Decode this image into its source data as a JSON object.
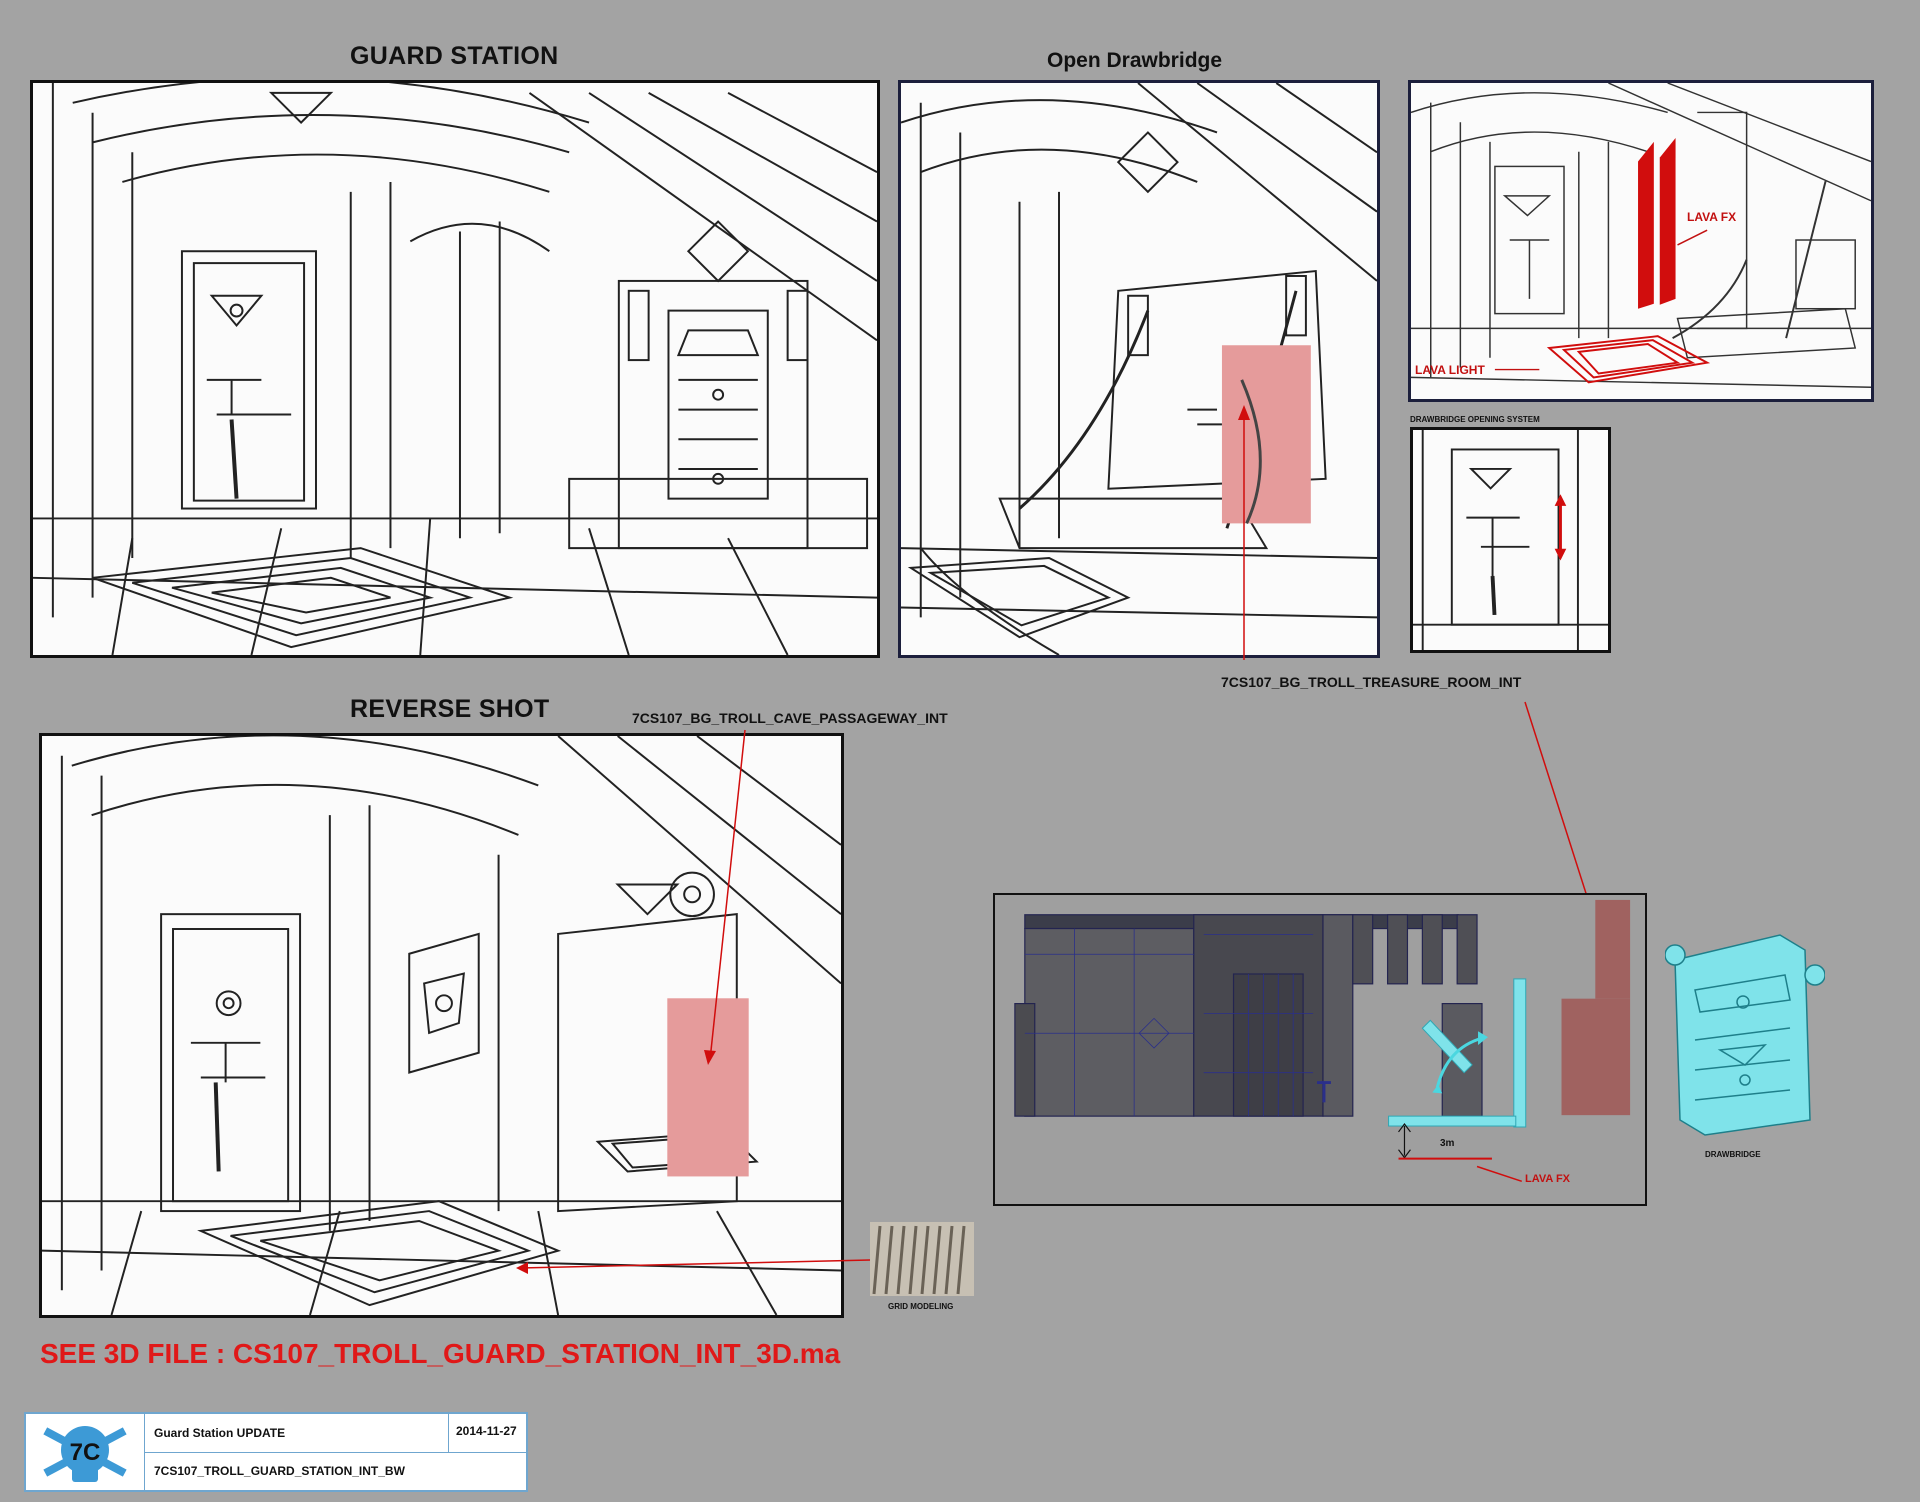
{
  "panels": {
    "guard_station": {
      "title": "GUARD STATION"
    },
    "open_drawbridge": {
      "title": "Open Drawbridge"
    },
    "reverse_shot": {
      "title": "REVERSE SHOT"
    },
    "lava_view": {
      "lava_fx_label": "LAVA FX",
      "lava_light_label": "LAVA LIGHT"
    },
    "opening_system": {
      "caption": "DRAWBRIDGE OPENING SYSTEM"
    }
  },
  "annotations": {
    "treasure_room": "7CS107_BG_TROLL_TREASURE_ROOM_INT",
    "cave_passageway": "7CS107_BG_TROLL_CAVE_PASSAGEWAY_INT",
    "grid_modeling": "GRID MODELING",
    "drawbridge": "DRAWBRIDGE",
    "model_height": "3m",
    "model_lava_fx": "LAVA FX"
  },
  "see_file": "SEE 3D FILE : CS107_TROLL_GUARD_STATION_INT_3D.ma",
  "title_block": {
    "logo_text": "7C",
    "subject": "Guard Station UPDATE",
    "date": "2014-11-27",
    "filename": "7CS107_TROLL_GUARD_STATION_INT_BW"
  },
  "colors": {
    "background": "#a3a3a3",
    "pink_doorway": "#e59b9b",
    "lava_red": "#d10d0d",
    "cyan_model": "#7fe3ea",
    "frame_navy": "#1c1f3c",
    "title_block_blue": "#6fa6cf"
  }
}
